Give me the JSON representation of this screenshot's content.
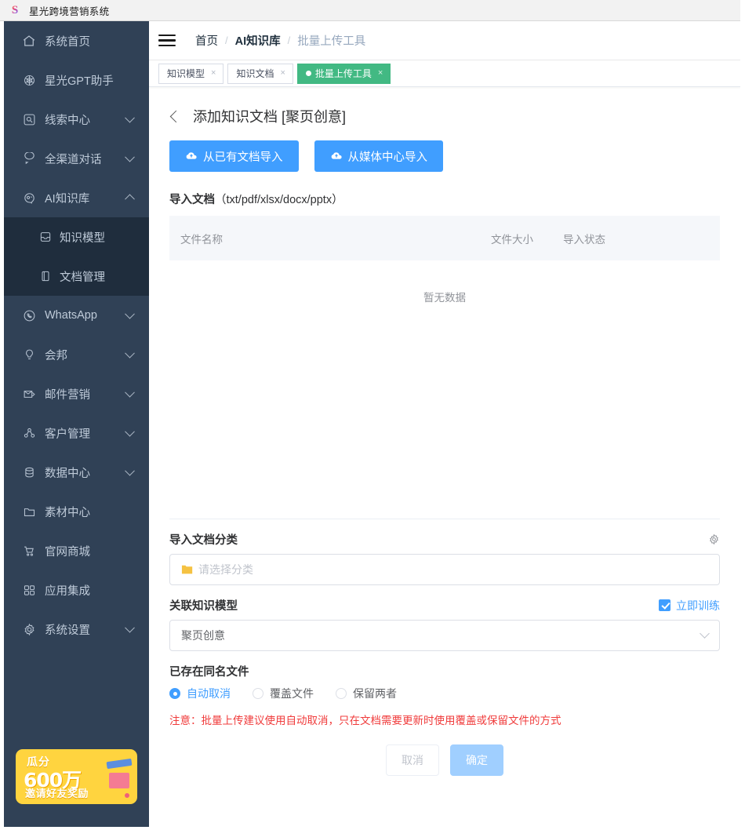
{
  "window": {
    "app_title": "星光跨境营销系统",
    "logo_letter": "S"
  },
  "sidebar": {
    "items": [
      {
        "label": "系统首页",
        "icon": "home-icon",
        "expandable": false
      },
      {
        "label": "星光GPT助手",
        "icon": "openai-icon",
        "expandable": false
      },
      {
        "label": "线索中心",
        "icon": "lead-icon",
        "expandable": true
      },
      {
        "label": "全渠道对话",
        "icon": "chat-icon",
        "expandable": true
      },
      {
        "label": "AI知识库",
        "icon": "ai-brain-icon",
        "expandable": true,
        "expanded": true
      }
    ],
    "submenu": [
      {
        "label": "知识模型",
        "icon": "model-icon"
      },
      {
        "label": "文档管理",
        "icon": "document-icon"
      }
    ],
    "items_after": [
      {
        "label": "WhatsApp",
        "icon": "whatsapp-icon",
        "expandable": true
      },
      {
        "label": "会邦",
        "icon": "bulb-icon",
        "expandable": true
      },
      {
        "label": "邮件营销",
        "icon": "mail-icon",
        "expandable": true
      },
      {
        "label": "客户管理",
        "icon": "customers-icon",
        "expandable": true
      },
      {
        "label": "数据中心",
        "icon": "database-icon",
        "expandable": true
      },
      {
        "label": "素材中心",
        "icon": "folder-icon",
        "expandable": false
      },
      {
        "label": "官网商城",
        "icon": "cart-icon",
        "expandable": false
      },
      {
        "label": "应用集成",
        "icon": "apps-icon",
        "expandable": false
      },
      {
        "label": "系统设置",
        "icon": "gear-icon",
        "expandable": true
      }
    ],
    "promo": {
      "line1": "瓜分",
      "line2": "600万",
      "line3": "邀请好友奖励"
    }
  },
  "navbar": {
    "menu_icon": "hamburger-icon",
    "breadcrumb": [
      "首页",
      "AI知识库",
      "批量上传工具"
    ],
    "separator": "/"
  },
  "tabs": [
    {
      "label": "知识模型",
      "active": false,
      "close": "×"
    },
    {
      "label": "知识文档",
      "active": false,
      "close": "×"
    },
    {
      "label": "批量上传工具",
      "active": true,
      "close": "×"
    }
  ],
  "page": {
    "title": "添加知识文档 [聚页创意]",
    "back_icon": "back-chevron-icon",
    "buttons": [
      {
        "label": "从已有文档导入",
        "icon": "cloud-upload-icon"
      },
      {
        "label": "从媒体中心导入",
        "icon": "cloud-upload-icon"
      }
    ],
    "import_section": {
      "title": "导入文档",
      "formats": "（txt/pdf/xlsx/docx/pptx）",
      "columns": [
        "文件名称",
        "文件大小",
        "导入状态"
      ],
      "rows": [],
      "empty_text": "暂无数据"
    },
    "category": {
      "label": "导入文档分类",
      "settings_icon": "gear-icon",
      "placeholder": "请选择分类",
      "value": "",
      "folder_icon": "folder-icon"
    },
    "model": {
      "label": "关联知识模型",
      "value": "聚页创意",
      "train_now_label": "立即训练",
      "train_now_checked": true
    },
    "duplicate": {
      "label": "已存在同名文件",
      "options": [
        "自动取消",
        "覆盖文件",
        "保留两者"
      ],
      "selected": "自动取消"
    },
    "warning": "注意：批量上传建议使用自动取消，只在文档需要更新时使用覆盖或保留文件的方式",
    "footer": {
      "cancel_label": "取消",
      "confirm_label": "确定"
    }
  },
  "colors": {
    "sidebar_bg": "#304156",
    "submenu_bg": "#1f2d3d",
    "primary": "#409eff",
    "tab_active": "#42b983",
    "warning_text": "#f03c3c",
    "promo_bg": "#ffd43f"
  }
}
